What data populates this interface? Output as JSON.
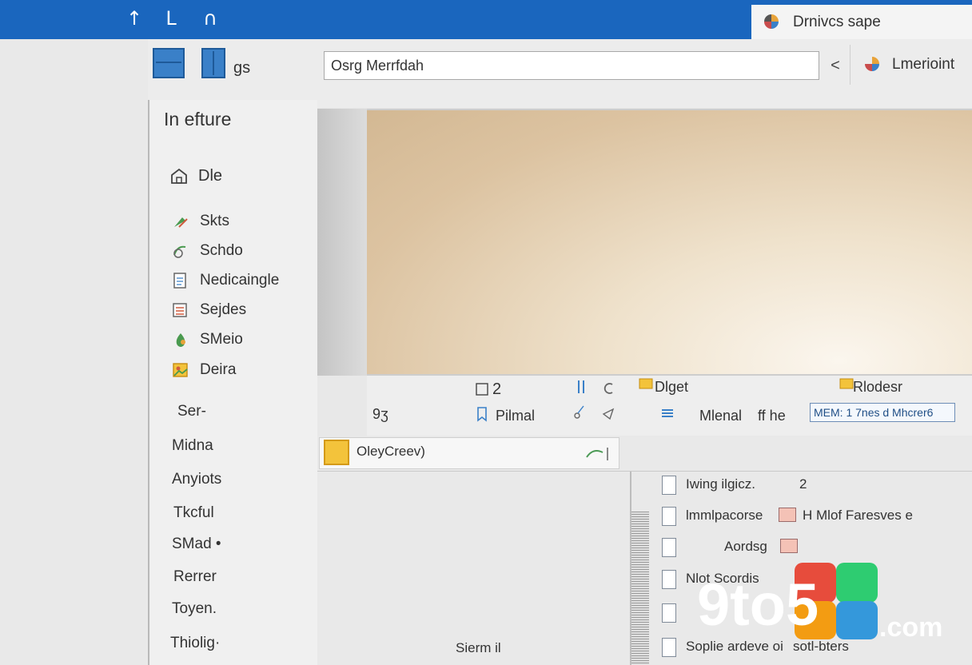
{
  "titlebar": {
    "nav_icons": [
      "up-arrow-icon",
      "l-shape-icon",
      "arch-icon"
    ],
    "nav_glyphs": [
      "↑",
      "L",
      "∩"
    ],
    "tab_label": "Drnivcs sape",
    "accent_color": "#1a66be"
  },
  "sidebar": {
    "view_label": "gs",
    "heading": "In efture",
    "group_label": "Dle",
    "items": [
      {
        "label": "Skts",
        "icon": "green-arrow-icon"
      },
      {
        "label": "Schdo",
        "icon": "shortcut-icon"
      },
      {
        "label": "Nedicaingle",
        "icon": "document-icon"
      },
      {
        "label": "Sejdes",
        "icon": "list-icon"
      },
      {
        "label": "SMeio",
        "icon": "color-drop-icon"
      },
      {
        "label": "Deira",
        "icon": "picture-icon"
      }
    ],
    "plain_items": [
      "Ser-",
      "Midna",
      "Anyiots",
      "Tkcful",
      "SMad •",
      "Rerrer",
      "Toyen.",
      "Thiolig·"
    ]
  },
  "address": {
    "value": "Osrg Merrfdah",
    "back_glyph": "<",
    "pane_label": "Lmerioint"
  },
  "preview": {
    "image_colors": [
      "#fbf6ee",
      "#dcc3a1",
      "#d3b893"
    ]
  },
  "info": {
    "left_text": "9ʒ",
    "count_text": "2",
    "label_primal": "Pilmal",
    "label_dlget": "Dlget",
    "label_rlodesr": "Rlodesr",
    "label_mlenal": "Mlenal",
    "label_fr": "ff  he",
    "tag_text": "MEM: 1 7nes d Mhcrer6"
  },
  "lower": {
    "selected_label": "OleyCreev)",
    "status_text": "Sierm il",
    "rows": [
      {
        "label": "Iwing ilgicz.",
        "extra": "2"
      },
      {
        "label": "lmmlpacorse",
        "extra": "H Mlof Faresves e"
      },
      {
        "label": "Aordsg",
        "extra": ""
      },
      {
        "label": "Nlot Scordis",
        "extra": ""
      },
      {
        "label": "",
        "extra": ""
      },
      {
        "label": "Soplie ardeve oi",
        "extra": "sotl-bters"
      }
    ]
  },
  "watermark": {
    "text": "9to5",
    "domain": ".com",
    "colors": [
      "#e74c3c",
      "#2ecc71",
      "#3498db",
      "#f39c12"
    ]
  }
}
